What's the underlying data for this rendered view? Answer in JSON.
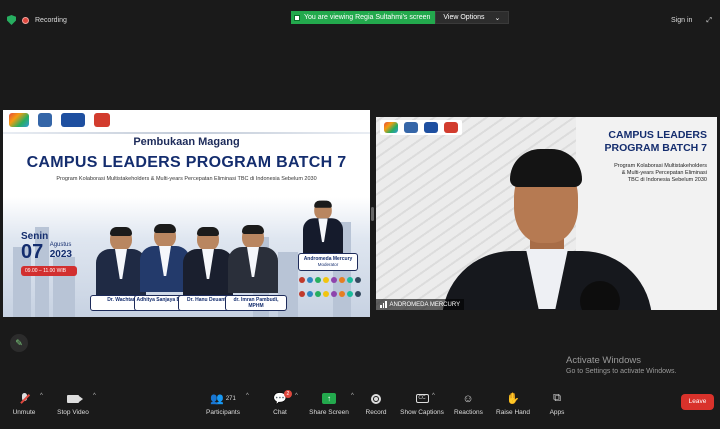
{
  "topbar": {
    "recording_label": "Recording",
    "viewing_banner": "You are viewing Regia Sultahmi's screen",
    "view_options_label": "View Options",
    "sign_in_label": "Sign in",
    "minimize_label": "Hide"
  },
  "slide": {
    "title_small": "Pembukaan Magang",
    "title_big": "CAMPUS LEADERS PROGRAM BATCH 7",
    "subtitle": "Program Kolaborasi Multistakeholders & Multi-years Percepatan Eliminasi TBC di Indonesia Sebelum 2030",
    "day": "Senin",
    "date_day": "07",
    "month": "Agustus",
    "year": "2023",
    "time": "09.00 – 11.00 WIB",
    "speakers": [
      {
        "name": "Dr. Wachtar",
        "role": ""
      },
      {
        "name": "Adhitya Sanjaya Budiko",
        "role": ""
      },
      {
        "name": "Dr. Hanu Deuantro",
        "role": ""
      },
      {
        "name": "dr. Imran Pambudi, MPHM",
        "role": ""
      }
    ],
    "moderator_name": "Andromeda Mercury",
    "moderator_role": "Moderator"
  },
  "video": {
    "title_line1": "CAMPUS LEADERS",
    "title_line2": "PROGRAM BATCH 7",
    "sub_line1": "Program Kolaborasi Multistakeholders",
    "sub_line2": "& Multi-years Percepatan Eliminasi",
    "sub_line3": "TBC di Indonesia Sebelum 2030",
    "participant_name": "ANDROMEDA MERCURY"
  },
  "activate": {
    "line1": "Activate Windows",
    "line2": "Go to Settings to activate Windows."
  },
  "toolbar": {
    "unmute": "Unmute",
    "stop_video": "Stop Video",
    "participants": "Participants",
    "participants_count": "271",
    "chat": "Chat",
    "chat_badge": "2",
    "share_screen": "Share Screen",
    "record": "Record",
    "show_captions": "Show Captions",
    "reactions": "Reactions",
    "raise_hand": "Raise Hand",
    "apps": "Apps",
    "leave": "Leave"
  },
  "colors": {
    "background": "#1a1a1a",
    "banner_green": "#23a94d",
    "leave_red": "#d9322b",
    "title_navy": "#142d6e"
  }
}
